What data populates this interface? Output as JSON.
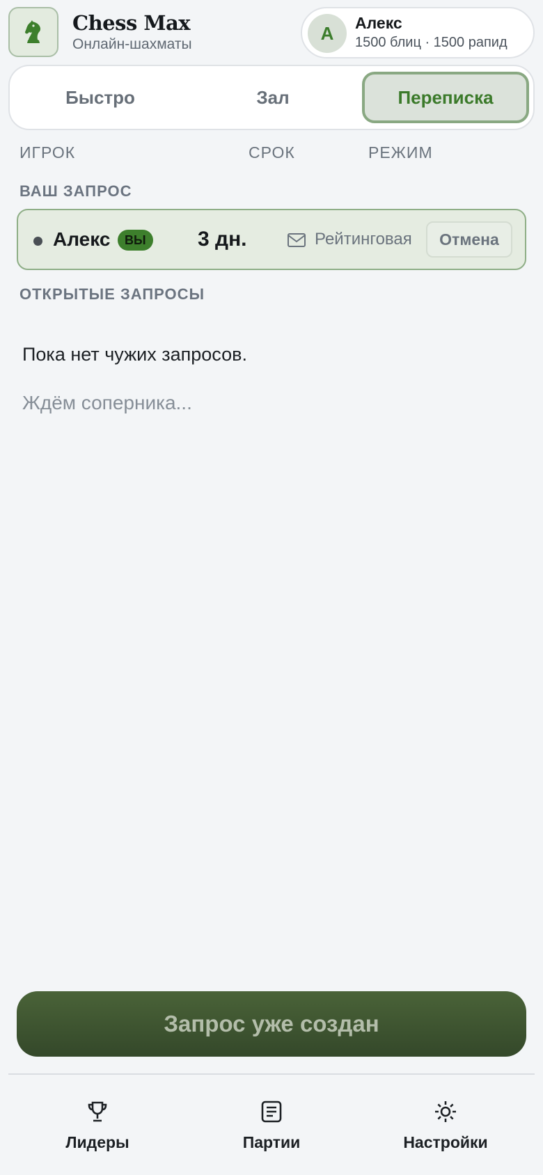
{
  "header": {
    "app_title": "Chess Max",
    "app_subtitle": "Онлайн-шахматы",
    "logo_icon": "knight-icon",
    "profile": {
      "avatar_letter": "А",
      "name": "Алекс",
      "rating": "1500 блиц · 1500 рапид"
    }
  },
  "tabs": [
    {
      "label": "Быстро",
      "active": false
    },
    {
      "label": "Зал",
      "active": false
    },
    {
      "label": "Переписка",
      "active": true
    }
  ],
  "columns": {
    "player": "ИГРОК",
    "term": "СРОК",
    "mode": "РЕЖИМ"
  },
  "your_request": {
    "section_title": "ВАШ ЗАПРОС",
    "player": "Алекс",
    "badge": "ВЫ",
    "term": "3 дн.",
    "mode_icon": "mail-icon",
    "mode": "Рейтинговая",
    "cancel_label": "Отмена"
  },
  "open_requests": {
    "section_title": "ОТКРЫТЫЕ ЗАПРОСЫ",
    "empty_text": "Пока нет чужих запросов.",
    "waiting_text": "Ждём соперника..."
  },
  "main_button_label": "Запрос уже создан",
  "bottom_nav": [
    {
      "label": "Лидеры",
      "icon": "trophy-icon"
    },
    {
      "label": "Партии",
      "icon": "list-icon"
    },
    {
      "label": "Настройки",
      "icon": "sun-icon"
    }
  ],
  "colors": {
    "accent": "#3d7f2c",
    "background": "#f3f5f7",
    "button": "#3f5631"
  }
}
